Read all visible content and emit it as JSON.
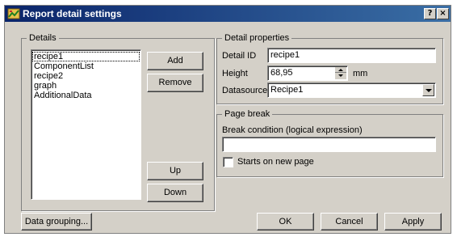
{
  "window": {
    "title": "Report detail settings",
    "help_button": "?",
    "close_button": "×"
  },
  "details": {
    "legend": "Details",
    "items": [
      "recipe1",
      "ComponentList",
      "recipe2",
      "graph",
      "AdditionalData"
    ],
    "selected": "recipe1",
    "add_label": "Add",
    "remove_label": "Remove",
    "up_label": "Up",
    "down_label": "Down"
  },
  "detail_properties": {
    "legend": "Detail properties",
    "detail_id_label": "Detail ID",
    "detail_id_value": "recipe1",
    "height_label": "Height",
    "height_value": "68,95",
    "height_unit": "mm",
    "datasource_label": "Datasource",
    "datasource_value": "Recipe1"
  },
  "page_break": {
    "legend": "Page break",
    "condition_label": "Break condition (logical expression)",
    "condition_value": "",
    "starts_new_page_label": "Starts on new page",
    "starts_new_page_checked": false
  },
  "footer": {
    "data_grouping_label": "Data grouping...",
    "ok_label": "OK",
    "cancel_label": "Cancel",
    "apply_label": "Apply"
  }
}
